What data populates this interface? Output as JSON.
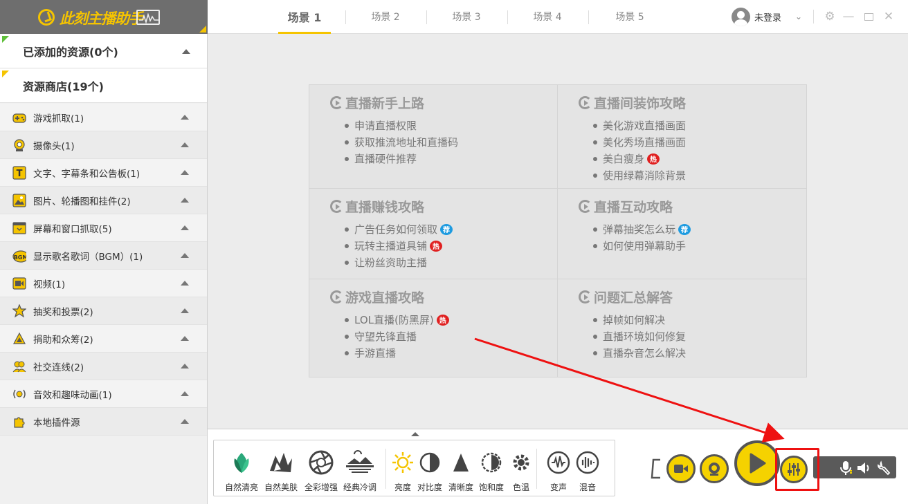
{
  "app": {
    "logo_text": "此刻主播助手"
  },
  "sidebar": {
    "added": {
      "label": "已添加的资源(0个)"
    },
    "store": {
      "label": "资源商店(19个)"
    },
    "items": [
      {
        "label": "游戏抓取(1)",
        "icon": "gamepad-icon"
      },
      {
        "label": "摄像头(1)",
        "icon": "webcam-icon"
      },
      {
        "label": "文字、字幕条和公告板(1)",
        "icon": "text-icon"
      },
      {
        "label": "图片、轮播图和挂件(2)",
        "icon": "image-icon"
      },
      {
        "label": "屏幕和窗口抓取(5)",
        "icon": "screen-capture-icon"
      },
      {
        "label": "显示歌名歌词（BGM）(1)",
        "icon": "bgm-icon"
      },
      {
        "label": "视频(1)",
        "icon": "video-icon"
      },
      {
        "label": "抽奖和投票(2)",
        "icon": "lottery-icon"
      },
      {
        "label": "捐助和众筹(2)",
        "icon": "donation-icon"
      },
      {
        "label": "社交连线(2)",
        "icon": "social-icon"
      },
      {
        "label": "音效和趣味动画(1)",
        "icon": "sound-effect-icon"
      },
      {
        "label": "本地插件源",
        "icon": "plugin-icon"
      }
    ]
  },
  "tabs": [
    {
      "label": "场景 1",
      "active": true
    },
    {
      "label": "场景 2"
    },
    {
      "label": "场景 3"
    },
    {
      "label": "场景 4"
    },
    {
      "label": "场景 5"
    }
  ],
  "user": {
    "label": "未登录"
  },
  "guide": {
    "cells": [
      {
        "title": "直播新手上路",
        "links": [
          {
            "text": "申请直播权限"
          },
          {
            "text": "获取推流地址和直播码"
          },
          {
            "text": "直播硬件推荐"
          }
        ]
      },
      {
        "title": "直播间装饰攻略",
        "links": [
          {
            "text": "美化游戏直播画面"
          },
          {
            "text": "美化秀场直播画面"
          },
          {
            "text": "美白瘦身",
            "badge": "热"
          },
          {
            "text": "使用绿幕消除背景"
          }
        ]
      },
      {
        "title": "直播赚钱攻略",
        "links": [
          {
            "text": "广告任务如何领取",
            "badge": "荐"
          },
          {
            "text": "玩转主播道具铺",
            "badge": "热"
          },
          {
            "text": "让粉丝资助主播"
          }
        ]
      },
      {
        "title": "直播互动攻略",
        "links": [
          {
            "text": "弹幕抽奖怎么玩",
            "badge": "荐"
          },
          {
            "text": "如何使用弹幕助手"
          }
        ]
      },
      {
        "title": "游戏直播攻略",
        "links": [
          {
            "text": "LOL直播(防黑屏)",
            "badge": "热"
          },
          {
            "text": "守望先锋直播"
          },
          {
            "text": "手游直播"
          }
        ]
      },
      {
        "title": "问题汇总解答",
        "links": [
          {
            "text": "掉帧如何解决"
          },
          {
            "text": "直播环境如何修复"
          },
          {
            "text": "直播杂音怎么解决"
          }
        ]
      }
    ]
  },
  "effects": {
    "filters": [
      {
        "label": "自然清亮",
        "icon": "leaf-filter-icon"
      },
      {
        "label": "自然美肤",
        "icon": "brush-filter-icon"
      },
      {
        "label": "全彩增强",
        "icon": "aperture-filter-icon"
      },
      {
        "label": "经典冷调",
        "icon": "landscape-filter-icon"
      }
    ],
    "adjust": [
      {
        "label": "亮度",
        "icon": "brightness-icon"
      },
      {
        "label": "对比度",
        "icon": "contrast-icon"
      },
      {
        "label": "清晰度",
        "icon": "sharpness-icon"
      },
      {
        "label": "饱和度",
        "icon": "saturation-icon"
      },
      {
        "label": "色温",
        "icon": "color-temp-icon"
      }
    ],
    "audio": [
      {
        "label": "变声",
        "icon": "voice-change-icon"
      },
      {
        "label": "混音",
        "icon": "mixer-icon"
      }
    ]
  },
  "colors": {
    "accent": "#f5c400",
    "highlight": "#e11111"
  }
}
